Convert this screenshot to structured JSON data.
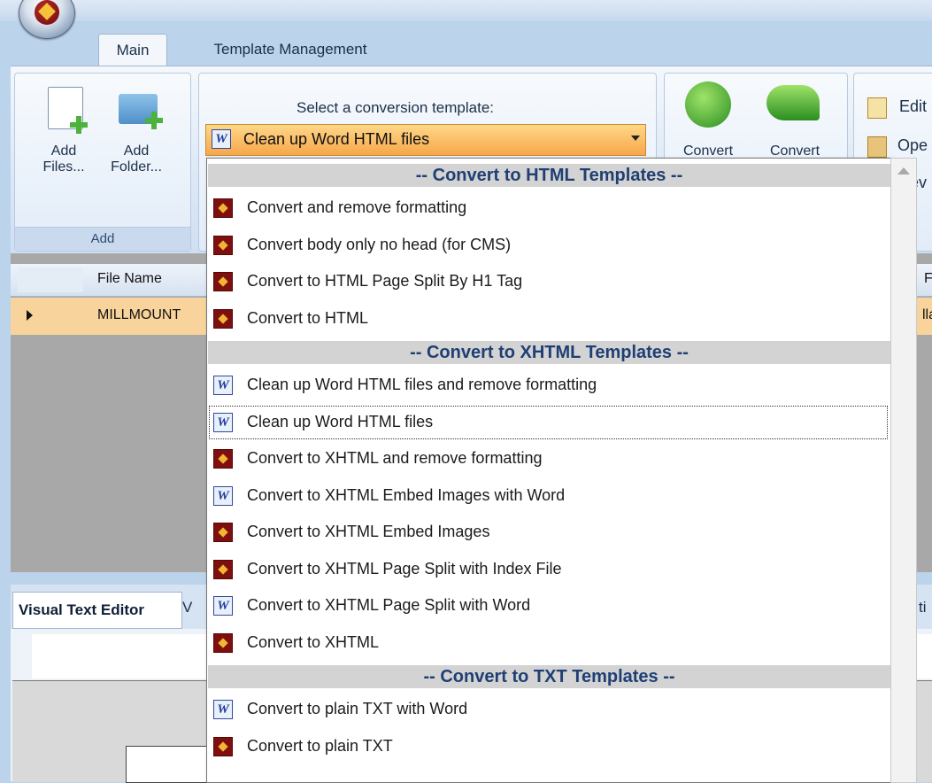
{
  "ribbon": {
    "tabs": [
      "Main",
      "Template Management"
    ],
    "add_group": {
      "add_files": "Add\nFiles...",
      "add_folder": "Add\nFolder...",
      "footer": "Add"
    },
    "convert_group": {
      "convert1": "Convert",
      "convert2": "Convert"
    },
    "right_group": {
      "edit": "Edit",
      "open": "Ope",
      "view": "ev"
    }
  },
  "template_select": {
    "label": "Select a conversion template:",
    "value": "Clean up Word HTML files"
  },
  "dropdown": {
    "groups": [
      {
        "header": "-- Convert to HTML Templates --",
        "items": [
          {
            "label": "Convert and remove formatting",
            "icon": "app"
          },
          {
            "label": "Convert body only no head (for CMS)",
            "icon": "app"
          },
          {
            "label": "Convert to HTML Page Split By H1 Tag",
            "icon": "app"
          },
          {
            "label": "Convert to HTML",
            "icon": "app"
          }
        ]
      },
      {
        "header": "-- Convert to XHTML Templates --",
        "items": [
          {
            "label": "Clean up Word HTML files and remove formatting",
            "icon": "word"
          },
          {
            "label": "Clean up Word HTML files",
            "icon": "word",
            "selected": true
          },
          {
            "label": "Convert to XHTML and remove formatting",
            "icon": "app"
          },
          {
            "label": "Convert to XHTML Embed Images with Word",
            "icon": "word"
          },
          {
            "label": "Convert to XHTML Embed Images",
            "icon": "app"
          },
          {
            "label": "Convert to XHTML Page Split with Index File",
            "icon": "app"
          },
          {
            "label": "Convert to XHTML Page Split with Word",
            "icon": "word"
          },
          {
            "label": "Convert to XHTML",
            "icon": "app"
          }
        ]
      },
      {
        "header": "-- Convert to TXT Templates --",
        "items": [
          {
            "label": "Convert to plain TXT with Word",
            "icon": "word"
          },
          {
            "label": "Convert to plain TXT",
            "icon": "app"
          }
        ]
      }
    ]
  },
  "grid": {
    "header_file": "File Name",
    "header_right": "F",
    "row_file": "MILLMOUNT",
    "row_right": "lla"
  },
  "editor": {
    "tab_visual": "Visual Text Editor",
    "tab_v": "V",
    "tab_right": "ti"
  }
}
